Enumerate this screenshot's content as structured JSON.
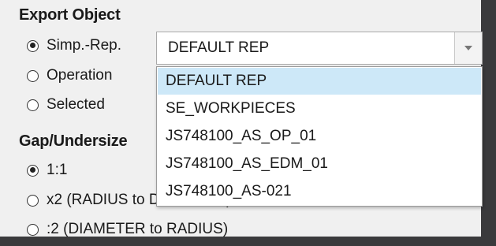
{
  "export_object": {
    "title": "Export Object",
    "options": [
      {
        "label": "Simp.-Rep.",
        "checked": true
      },
      {
        "label": "Operation",
        "checked": false
      },
      {
        "label": "Selected",
        "checked": false
      }
    ],
    "combo": {
      "value": "DEFAULT REP",
      "dropdown_icon": "chevron-down-icon",
      "options": [
        "DEFAULT REP",
        "SE_WORKPIECES",
        "JS748100_AS_OP_01",
        "JS748100_AS_EDM_01",
        "JS748100_AS-021"
      ],
      "highlighted_index": 0
    }
  },
  "gap_undersize": {
    "title": "Gap/Undersize",
    "options": [
      {
        "label": "1:1",
        "checked": true
      },
      {
        "label": "x2 (RADIUS to DIAMETER)",
        "checked": false
      },
      {
        "label": ":2 (DIAMETER to RADIUS)",
        "checked": false
      }
    ]
  },
  "colors": {
    "panel_bg": "#f0f0f0",
    "outer_bg": "#3a3a3c",
    "highlight": "#cde8f8"
  }
}
